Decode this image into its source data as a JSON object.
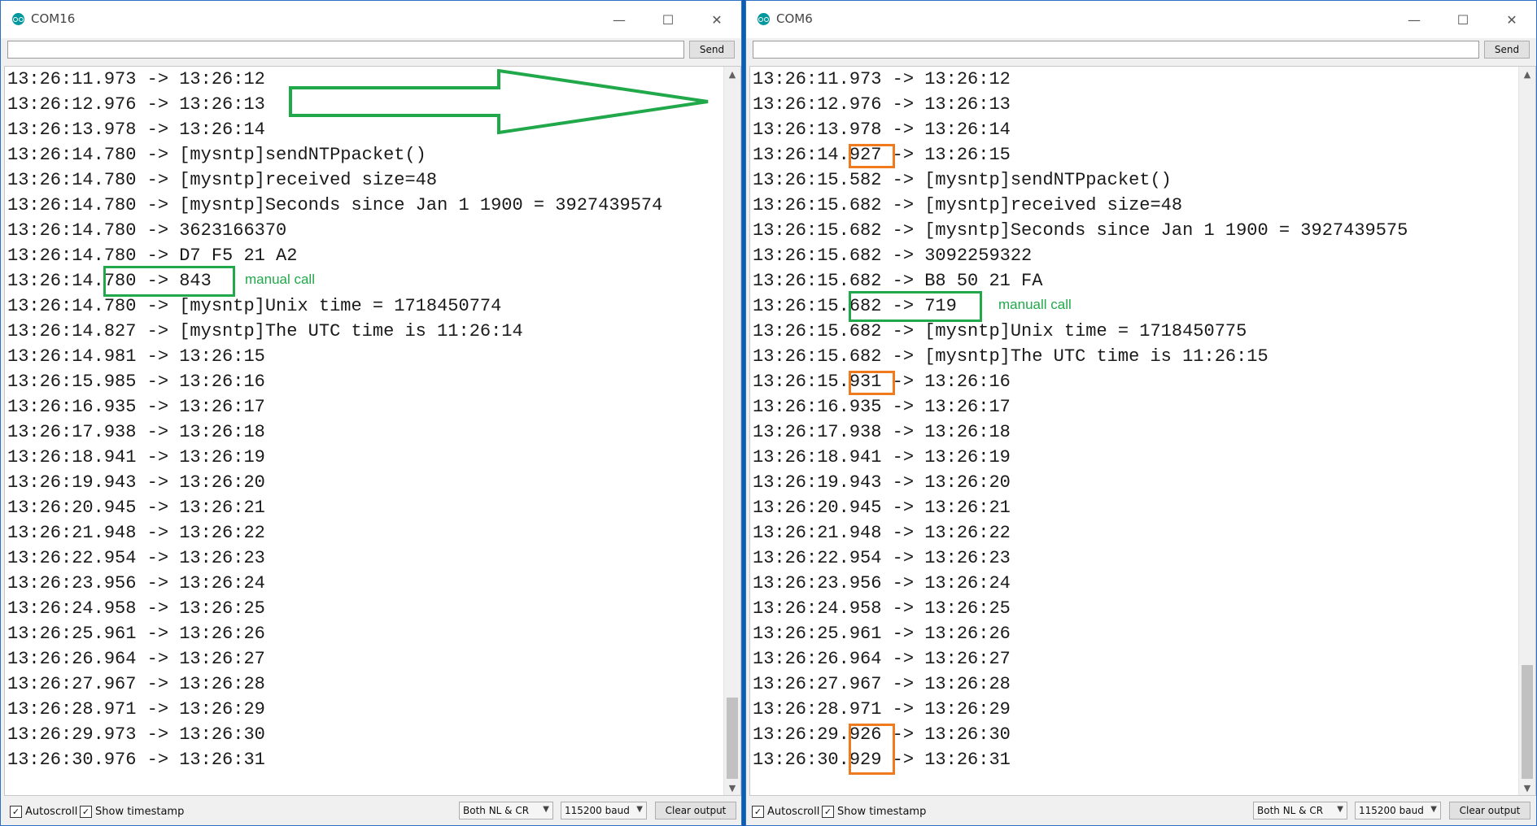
{
  "left": {
    "title": "COM16",
    "send_input_value": "",
    "send_label": "Send",
    "lines": [
      "13:26:11.973 -> 13:26:12",
      "13:26:12.976 -> 13:26:13",
      "13:26:13.978 -> 13:26:14",
      "13:26:14.780 -> [mysntp]sendNTPpacket()",
      "13:26:14.780 -> [mysntp]received size=48",
      "13:26:14.780 -> [mysntp]Seconds since Jan 1 1900 = 3927439574",
      "13:26:14.780 -> 3623166370",
      "13:26:14.780 -> D7 F5 21 A2",
      "13:26:14.780 -> 843",
      "13:26:14.780 -> [mysntp]Unix time = 1718450774",
      "13:26:14.827 -> [mysntp]The UTC time is 11:26:14",
      "13:26:14.981 -> 13:26:15",
      "13:26:15.985 -> 13:26:16",
      "13:26:16.935 -> 13:26:17",
      "13:26:17.938 -> 13:26:18",
      "13:26:18.941 -> 13:26:19",
      "13:26:19.943 -> 13:26:20",
      "13:26:20.945 -> 13:26:21",
      "13:26:21.948 -> 13:26:22",
      "13:26:22.954 -> 13:26:23",
      "13:26:23.956 -> 13:26:24",
      "13:26:24.958 -> 13:26:25",
      "13:26:25.961 -> 13:26:26",
      "13:26:26.964 -> 13:26:27",
      "13:26:27.967 -> 13:26:28",
      "13:26:28.971 -> 13:26:29",
      "13:26:29.973 -> 13:26:30",
      "13:26:30.976 -> 13:26:31"
    ],
    "autoscroll_label": "Autoscroll",
    "timestamp_label": "Show timestamp",
    "line_ending": "Both NL & CR",
    "baud": "115200 baud",
    "clear_label": "Clear output",
    "annotation": "manual call"
  },
  "right": {
    "title": "COM6",
    "send_input_value": "",
    "send_label": "Send",
    "lines": [
      "13:26:11.973 -> 13:26:12",
      "13:26:12.976 -> 13:26:13",
      "13:26:13.978 -> 13:26:14",
      "13:26:14.927 -> 13:26:15",
      "13:26:15.582 -> [mysntp]sendNTPpacket()",
      "13:26:15.682 -> [mysntp]received size=48",
      "13:26:15.682 -> [mysntp]Seconds since Jan 1 1900 = 3927439575",
      "13:26:15.682 -> 3092259322",
      "13:26:15.682 -> B8 50 21 FA",
      "13:26:15.682 -> 719",
      "13:26:15.682 -> [mysntp]Unix time = 1718450775",
      "13:26:15.682 -> [mysntp]The UTC time is 11:26:15",
      "13:26:15.931 -> 13:26:16",
      "13:26:16.935 -> 13:26:17",
      "13:26:17.938 -> 13:26:18",
      "13:26:18.941 -> 13:26:19",
      "13:26:19.943 -> 13:26:20",
      "13:26:20.945 -> 13:26:21",
      "13:26:21.948 -> 13:26:22",
      "13:26:22.954 -> 13:26:23",
      "13:26:23.956 -> 13:26:24",
      "13:26:24.958 -> 13:26:25",
      "13:26:25.961 -> 13:26:26",
      "13:26:26.964 -> 13:26:27",
      "13:26:27.967 -> 13:26:28",
      "13:26:28.971 -> 13:26:29",
      "13:26:29.926 -> 13:26:30",
      "13:26:30.929 -> 13:26:31"
    ],
    "autoscroll_label": "Autoscroll",
    "timestamp_label": "Show timestamp",
    "line_ending": "Both NL & CR",
    "baud": "115200 baud",
    "clear_label": "Clear output",
    "annotation": "manuall call"
  },
  "icons": {
    "minimize": "minimize-icon",
    "maximize": "maximize-icon",
    "close": "close-icon",
    "checkbox": "checkbox-icon",
    "dropdown": "chevron-down-icon"
  },
  "colors": {
    "annotation_green": "#21a84a",
    "annotation_orange": "#f07a1e",
    "arduino_teal": "#00979d"
  }
}
